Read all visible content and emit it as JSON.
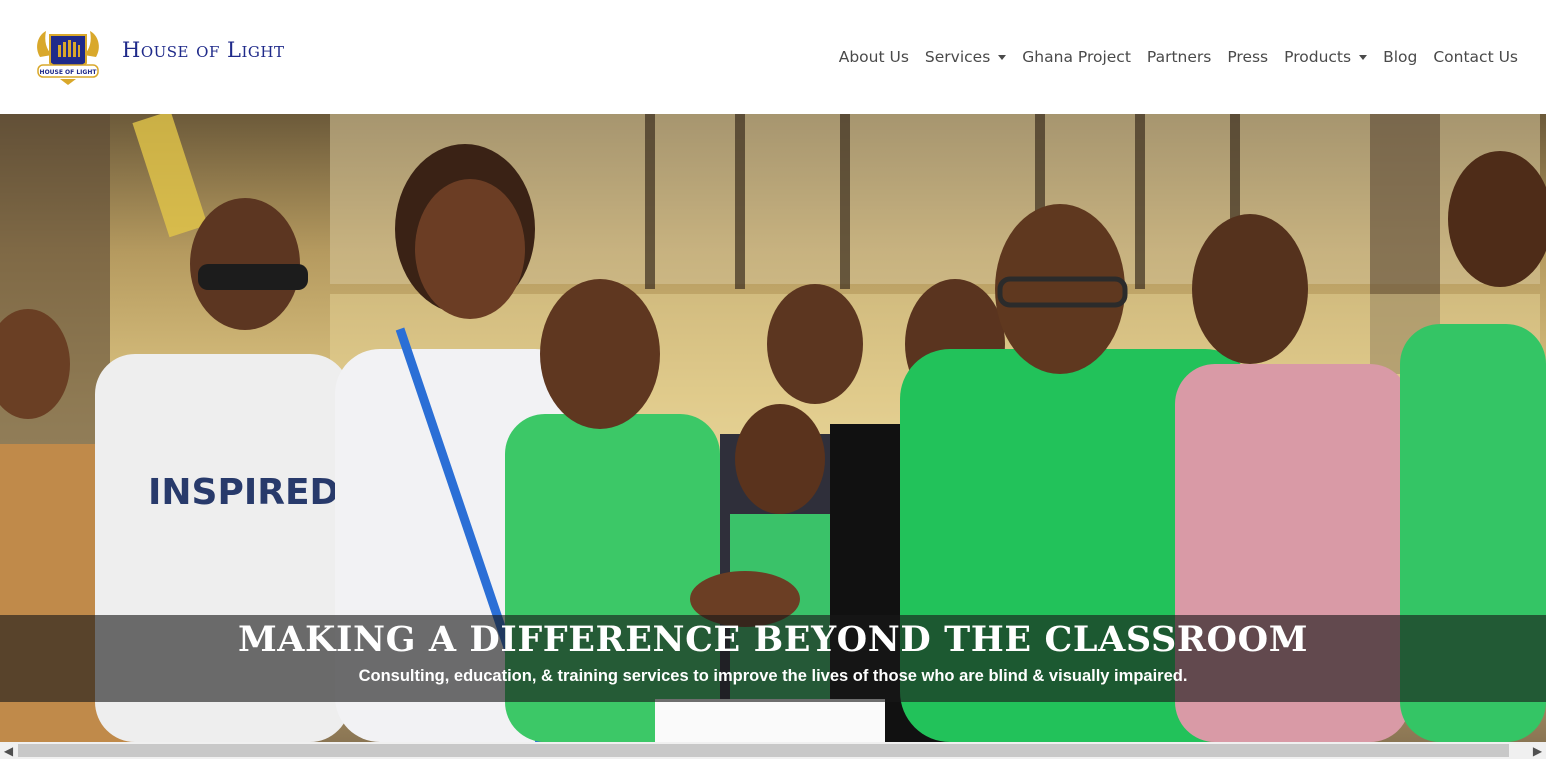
{
  "brand": {
    "name": "House of Light",
    "logo_text": "HOUSE OF LIGHT"
  },
  "nav": {
    "items": [
      {
        "label": "About Us",
        "dropdown": false
      },
      {
        "label": "Services",
        "dropdown": true
      },
      {
        "label": "Ghana Project",
        "dropdown": false
      },
      {
        "label": "Partners",
        "dropdown": false
      },
      {
        "label": "Press",
        "dropdown": false
      },
      {
        "label": "Products",
        "dropdown": true
      },
      {
        "label": "Blog",
        "dropdown": false
      },
      {
        "label": "Contact Us",
        "dropdown": false
      }
    ]
  },
  "hero": {
    "title": "MAKING A DIFFERENCE BEYOND THE CLASSROOM",
    "subtitle": "Consulting, education, & training services to improve the lives of those who are blind & visually impaired.",
    "shirt_text": "INSPIRED"
  },
  "scrollbar": {
    "left_arrow": "◀",
    "right_arrow": "▶"
  },
  "colors": {
    "brand_navy": "#1f2a8a",
    "nav_text": "#4a4a4a",
    "shirt_green": "#22c25a",
    "caption_bg": "#191919"
  }
}
